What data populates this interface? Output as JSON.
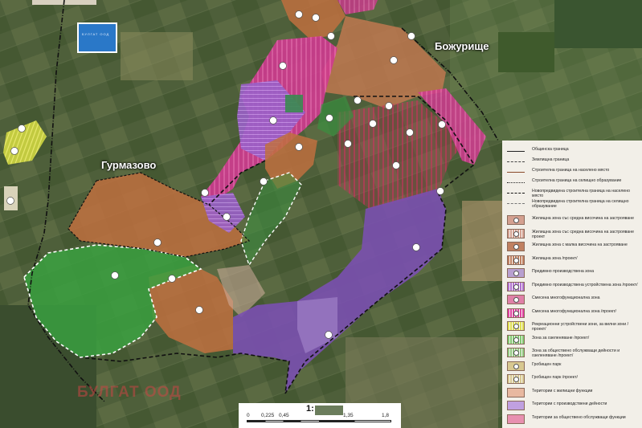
{
  "places": {
    "bozhurishte": "Божурище",
    "gurmazovo": "Гурмазово"
  },
  "logo_text": "БУЛГАТ ООД",
  "watermark": "БУЛГАТ ООД",
  "scale": {
    "title": "1:",
    "ticks": [
      "0",
      "0,225",
      "0,45",
      "1,35",
      "1,8"
    ]
  },
  "legend": {
    "lines": [
      {
        "label": "Общинска граница",
        "style": "municipal"
      },
      {
        "label": "Землищна граница",
        "style": "land"
      },
      {
        "label": "Строителна граница на населено място",
        "style": "build"
      },
      {
        "label": "Строителна граница на селищно образувание",
        "style": "settle"
      },
      {
        "label": "Новопредвидена строителна граница на населено място",
        "style": "new-build"
      },
      {
        "label": "Новопредвидена строителна граница на селищно образувание",
        "style": "new-settle"
      }
    ],
    "items": [
      {
        "label": "Жилищна зона със средна височина на застрояване",
        "color": "#d4a090",
        "hatch": false
      },
      {
        "label": "Жилищна зона със средна височина на застрояване проект",
        "color": "#d4a090",
        "hatch": true
      },
      {
        "label": "Жилищна зона с малка височина на застрояване",
        "color": "#c08060",
        "hatch": false
      },
      {
        "label": "Жилищна зона /проект/",
        "color": "#c08060",
        "hatch": true
      },
      {
        "label": "Предимно производствена зона",
        "color": "#b8a0d0",
        "hatch": false
      },
      {
        "label": "Предимно производствена устройствена зона /проект/",
        "color": "#b070d0",
        "hatch": true
      },
      {
        "label": "Смесена многофункционална зона",
        "color": "#e080a8",
        "hatch": false
      },
      {
        "label": "Смесена многофункционална зона /проект/",
        "color": "#e040a0",
        "hatch": true
      },
      {
        "label": "Рекреационни устройствени зони, за вилни зони /проект/",
        "color": "#e0e050",
        "hatch": true
      },
      {
        "label": "Зона за озеленяване /проект/",
        "color": "#80c870",
        "hatch": true
      },
      {
        "label": "Зона за обществено обслужващи дейности и озеленяване /проект/",
        "color": "#90c880",
        "hatch": true
      },
      {
        "label": "Гробищен парк",
        "color": "#d8c890",
        "hatch": false
      },
      {
        "label": "Гробищен парк /проект/",
        "color": "#d8c890",
        "hatch": true
      },
      {
        "label": "Територии с жилищни функции",
        "color": "#e8b8a0",
        "hatch": false
      },
      {
        "label": "Територии с производствени дейности",
        "color": "#c0a0e0",
        "hatch": false
      },
      {
        "label": "Територии за обществено обслужващи функции",
        "color": "#e890b0",
        "hatch": false
      }
    ]
  }
}
